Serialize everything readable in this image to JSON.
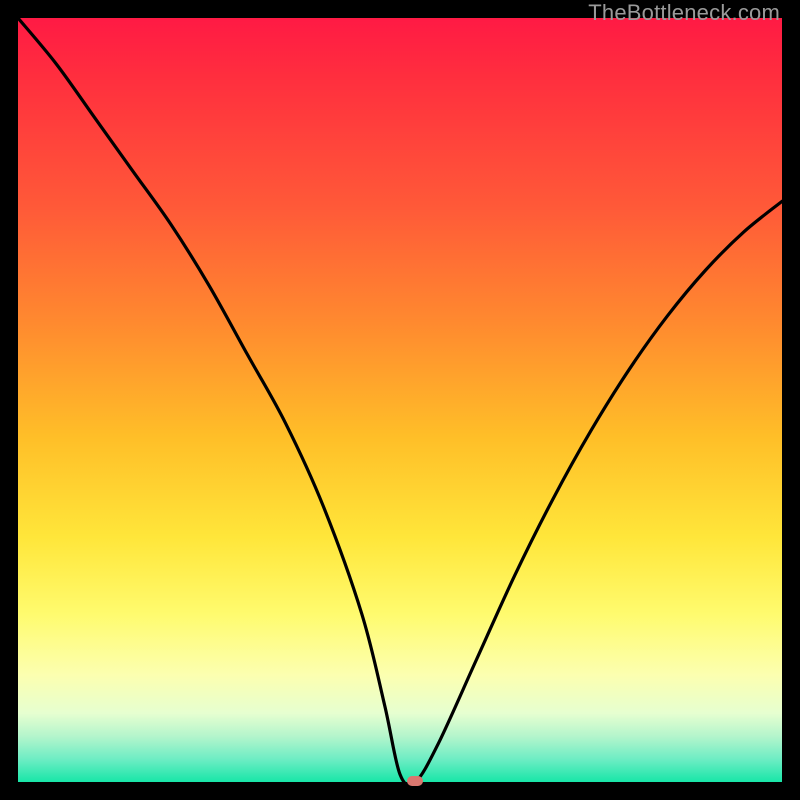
{
  "watermark": "TheBottleneck.com",
  "colors": {
    "background": "#000000",
    "curve": "#000000",
    "marker": "#d9776f",
    "gradient_top": "#ff1a44",
    "gradient_bottom": "#18e6a8"
  },
  "chart_data": {
    "type": "line",
    "title": "",
    "xlabel": "",
    "ylabel": "",
    "xlim": [
      0,
      100
    ],
    "ylim": [
      0,
      100
    ],
    "grid": false,
    "legend": false,
    "annotations": [
      {
        "text": "TheBottleneck.com",
        "position": "top-right"
      }
    ],
    "series": [
      {
        "name": "bottleneck-curve",
        "x": [
          0,
          5,
          10,
          15,
          20,
          25,
          30,
          35,
          40,
          45,
          48,
          50,
          52,
          55,
          60,
          65,
          70,
          75,
          80,
          85,
          90,
          95,
          100
        ],
        "values": [
          100,
          94,
          87,
          80,
          73,
          65,
          56,
          47,
          36,
          22,
          10,
          1,
          0,
          5,
          16,
          27,
          37,
          46,
          54,
          61,
          67,
          72,
          76
        ]
      }
    ],
    "marker": {
      "x": 52,
      "y": 0
    }
  }
}
